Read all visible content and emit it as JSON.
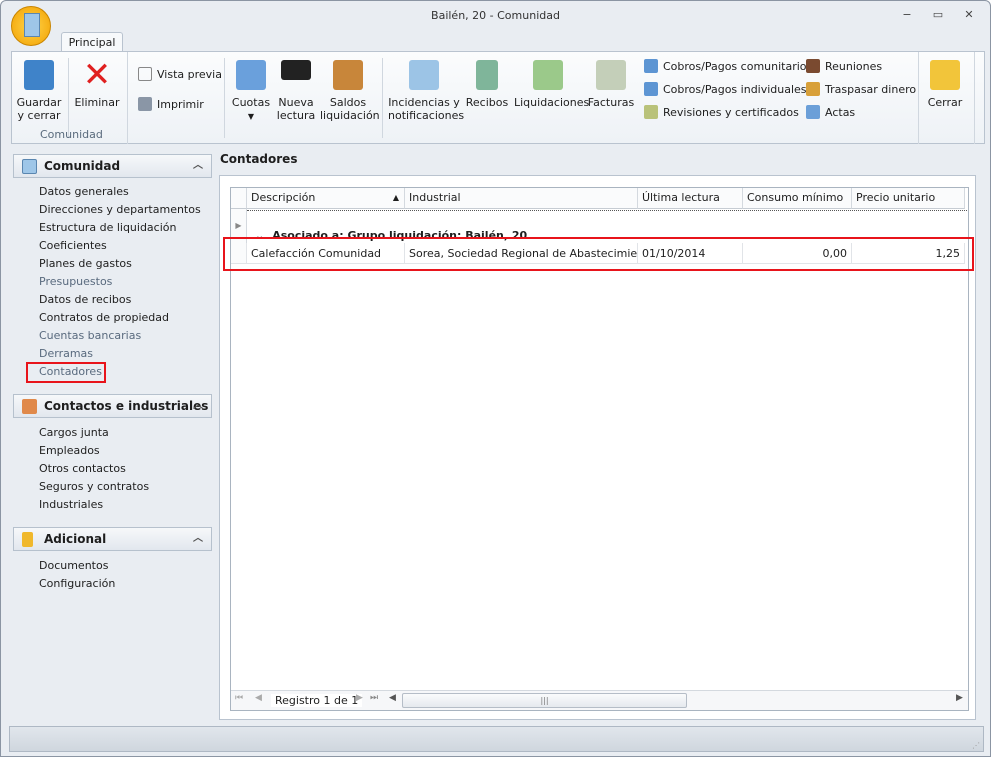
{
  "window": {
    "title": "Bailén, 20 - Comunidad",
    "minimize": "−",
    "maximize": "▭",
    "close": "✕"
  },
  "ribbon": {
    "tab": "Principal",
    "group_comunidad": "Comunidad",
    "buttons": {
      "guardar": "Guardar y cerrar",
      "eliminar": "Eliminar",
      "vista_previa": "Vista previa",
      "imprimir": "Imprimir",
      "cuotas": "Cuotas",
      "nueva_lectura": "Nueva lectura",
      "saldos": "Saldos liquidación",
      "incidencias": "Incidencias y notificaciones",
      "recibos": "Recibos",
      "liquidaciones": "Liquidaciones",
      "facturas": "Facturas",
      "cobros_com": "Cobros/Pagos comunitarios",
      "cobros_ind": "Cobros/Pagos individuales",
      "revisiones": "Revisiones y certificados",
      "reuniones": "Reuniones",
      "traspasar": "Traspasar dinero",
      "actas": "Actas",
      "cerrar": "Cerrar"
    }
  },
  "sidebar": {
    "comunidad": {
      "title": "Comunidad",
      "items": [
        "Datos generales",
        "Direcciones y departamentos",
        "Estructura de liquidación",
        "Coeficientes",
        "Planes de gastos",
        "Presupuestos",
        "Datos de recibos",
        "Contratos de propiedad",
        "Cuentas bancarias",
        "Derramas",
        "Contadores"
      ]
    },
    "contactos": {
      "title": "Contactos e industriales",
      "items": [
        "Cargos junta",
        "Empleados",
        "Otros contactos",
        "Seguros y contratos",
        "Industriales"
      ]
    },
    "adicional": {
      "title": "Adicional",
      "items": [
        "Documentos",
        "Configuración"
      ]
    }
  },
  "main": {
    "title": "Contadores",
    "columns": [
      "Descripción",
      "Industrial",
      "Última lectura",
      "Consumo mínimo",
      "Precio unitario"
    ],
    "group": "Asociado a: Grupo liquidación: Bailén, 20",
    "rows": [
      [
        "Calefacción Comunidad",
        "Sorea, Sociedad Regional de Abastecimiento",
        "01/10/2014",
        "0,00",
        "1,25"
      ]
    ],
    "navigator": "Registro 1 de 1"
  },
  "colors": {
    "highlight": "#e8141b"
  }
}
